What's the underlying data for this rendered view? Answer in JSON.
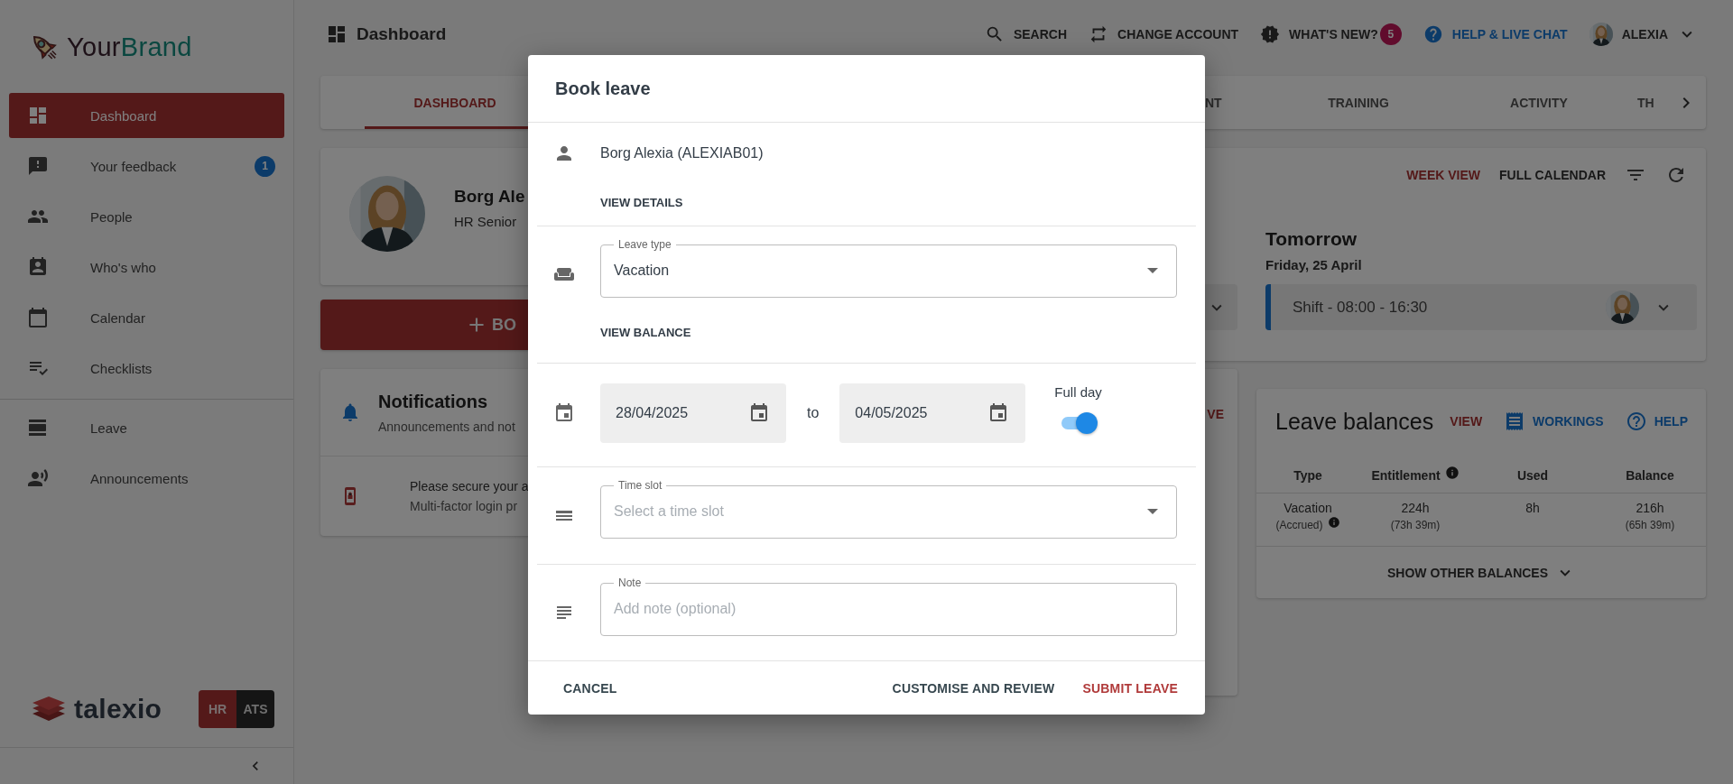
{
  "sidebar": {
    "brand": {
      "first": "Your",
      "second": "Brand"
    },
    "groups": [
      [
        {
          "label": "Dashboard",
          "selected": true
        },
        {
          "label": "Your feedback",
          "selected": false,
          "badge": "1"
        },
        {
          "label": "People",
          "selected": false
        },
        {
          "label": "Who's who",
          "selected": false
        },
        {
          "label": "Calendar",
          "selected": false
        },
        {
          "label": "Checklists",
          "selected": false
        }
      ],
      [
        {
          "label": "Leave",
          "selected": false
        },
        {
          "label": "Announcements",
          "selected": false
        }
      ]
    ],
    "product": "talexio",
    "modules": [
      {
        "label": "HR",
        "selected": true
      },
      {
        "label": "ATS",
        "selected": false
      }
    ]
  },
  "header": {
    "title": "Dashboard",
    "actions": [
      {
        "kind": "search",
        "label": "SEARCH"
      },
      {
        "kind": "account",
        "label": "CHANGE ACCOUNT"
      },
      {
        "kind": "news",
        "label": "WHAT'S NEW?",
        "badge": "5"
      },
      {
        "kind": "help",
        "label": "HELP & LIVE CHAT"
      }
    ],
    "user": "ALEXIA"
  },
  "tabs": [
    {
      "label": "DASHBOARD",
      "selected": true
    },
    {
      "label": "NT",
      "selected": false
    },
    {
      "label": "TRAINING",
      "selected": false
    },
    {
      "label": "ACTIVITY",
      "selected": false
    },
    {
      "label": "TH",
      "selected": false
    }
  ],
  "profile": {
    "name": "Borg Ale",
    "role": "HR Senior"
  },
  "book_button": "BO",
  "notifications": {
    "title": "Notifications",
    "subtitle": "Announcements and not",
    "items": [
      {
        "title": "Please secure your a",
        "text": "Multi-factor login pr"
      }
    ]
  },
  "middle_card": {
    "link": "VE"
  },
  "calendar": {
    "views": [
      {
        "label": "WEEK VIEW",
        "selected": true
      },
      {
        "label": "FULL CALENDAR",
        "selected": false
      }
    ],
    "day": "Tomorrow",
    "date": "Friday, 25 April",
    "shift": "Shift - 08:00 - 16:30"
  },
  "leave_balances": {
    "title": "Leave balances",
    "actions": [
      {
        "kind": "view",
        "label": "VIEW"
      },
      {
        "kind": "workings",
        "label": "WORKINGS"
      },
      {
        "kind": "help",
        "label": "HELP"
      }
    ],
    "columns": [
      {
        "label": "Type",
        "info": false
      },
      {
        "label": "Entitlement",
        "info": true
      },
      {
        "label": "Used",
        "info": false
      },
      {
        "label": "Balance",
        "info": false
      }
    ],
    "rows": [
      [
        {
          "value": "Vacation",
          "note": "(Accrued)",
          "info": true
        },
        {
          "value": "224h",
          "note": "(73h 39m)",
          "info": false
        },
        {
          "value": "8h",
          "info": false
        },
        {
          "value": "216h",
          "note": "(65h 39m)",
          "info": false
        }
      ]
    ],
    "more": "SHOW OTHER BALANCES"
  },
  "dialog": {
    "title": "Book leave",
    "employee": "Borg Alexia (ALEXIAB01)",
    "view_details": "VIEW DETAILS",
    "leave_type": {
      "label": "Leave type",
      "value": "Vacation"
    },
    "view_balance": "VIEW BALANCE",
    "dates": {
      "from": "28/04/2025",
      "separator": "to",
      "to": "04/05/2025"
    },
    "full_day": {
      "label": "Full day",
      "on": true
    },
    "time_slot": {
      "label": "Time slot",
      "placeholder": "Select a time slot"
    },
    "note": {
      "label": "Note",
      "placeholder": "Add note (optional)"
    },
    "buttons": [
      {
        "kind": "plain",
        "label": "CANCEL"
      },
      {
        "kind": "plain",
        "label": "CUSTOMISE AND REVIEW"
      },
      {
        "kind": "primary",
        "label": "SUBMIT LEAVE"
      }
    ]
  }
}
